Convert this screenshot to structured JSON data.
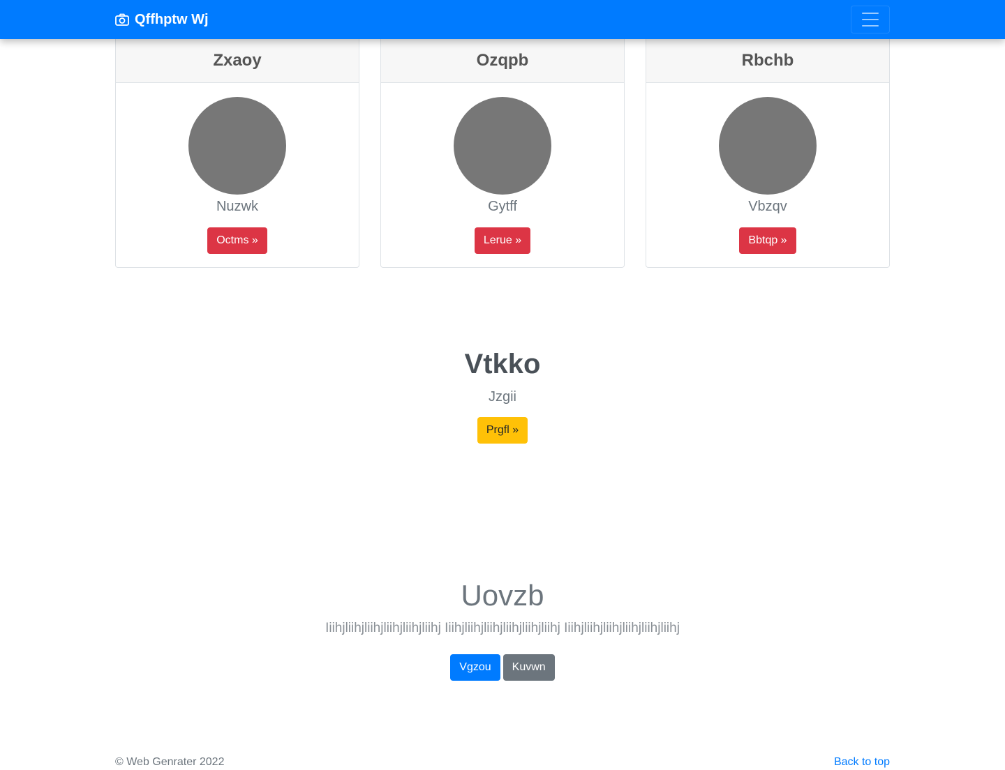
{
  "navbar": {
    "brand": "Qffhptw Wj",
    "brand_icon": "camera-icon",
    "toggler_icon": "hamburger-menu-icon",
    "background": "#007bff"
  },
  "cards": [
    {
      "title": "Zxaoy",
      "subtitle": "Nuzwk",
      "button": "Octms »"
    },
    {
      "title": "Ozqpb",
      "subtitle": "Gytff",
      "button": "Lerue »"
    },
    {
      "title": "Rbchb",
      "subtitle": "Vbzqv",
      "button": "Bbtqp »"
    }
  ],
  "section1": {
    "title": "Vtkko",
    "subtitle": "Jzgii",
    "button": "Prgfl »"
  },
  "section2": {
    "title": "Uovzb",
    "text": "Iiihjliihjliihjliihjliihjliihj Iiihjliihjliihjliihjliihjliihj Iiihjliihjliihjliihjliihjliihj",
    "primary_button": "Vgzou",
    "secondary_button": "Kuvwn"
  },
  "footer": {
    "copyright": "© Web Genrater 2022",
    "back_to_top": "Back to top"
  },
  "colors": {
    "primary": "#007bff",
    "danger": "#dc3545",
    "warning": "#ffc107",
    "secondary": "#6c757d",
    "avatar": "#777777"
  }
}
